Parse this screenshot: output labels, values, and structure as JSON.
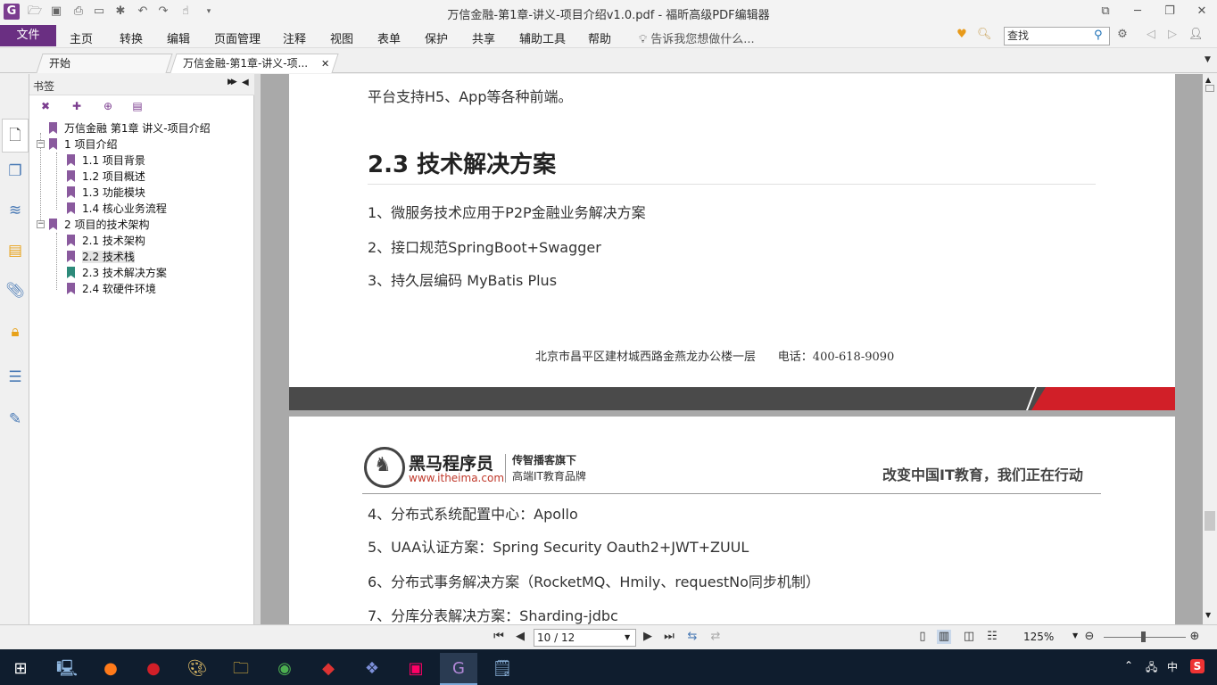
{
  "window": {
    "title": "万信金融-第1章-讲义-项目介绍v1.0.pdf - 福昕高级PDF编辑器",
    "app_logo": "G",
    "buttons": {
      "restore_layout": "⧉",
      "minimize": "─",
      "maximize": "❐",
      "close": "✕"
    }
  },
  "menu": {
    "file": "文件",
    "items": [
      "主页",
      "转换",
      "编辑",
      "页面管理",
      "注释",
      "视图",
      "表单",
      "保护",
      "共享",
      "辅助工具",
      "帮助"
    ],
    "tellme": "告诉我您想做什么...",
    "search_value": "查找"
  },
  "tabs": [
    {
      "label": "开始"
    },
    {
      "label": "万信金融-第1章-讲义-项...",
      "close": "✕"
    }
  ],
  "bookmarks": {
    "title": "书签",
    "collapse_glyph": "▶▶",
    "pin_glyph": "◀",
    "tree": [
      {
        "label": "万信金融 第1章 讲义-项目介绍"
      },
      {
        "label": "1 项目介绍",
        "toggle": "−"
      },
      {
        "label": "1.1 项目背景"
      },
      {
        "label": "1.2 项目概述"
      },
      {
        "label": "1.3 功能模块"
      },
      {
        "label": "1.4 核心业务流程"
      },
      {
        "label": "2 项目的技术架构",
        "toggle": "−"
      },
      {
        "label": "2.1 技术架构"
      },
      {
        "label": "2.2 技术栈"
      },
      {
        "label": "2.3 技术解决方案"
      },
      {
        "label": "2.4 软硬件环境"
      }
    ]
  },
  "document": {
    "page1": {
      "line_top": "平台支持H5、App等各种前端。",
      "heading": "2.3 技术解决方案",
      "items": [
        "1、微服务技术应用于P2P金融业务解决方案",
        "2、接口规范SpringBoot+Swagger",
        "3、持久层编码 MyBatis Plus"
      ],
      "footer": "北京市昌平区建材城西路金燕龙办公楼一层      电话：400-618-9090"
    },
    "page2": {
      "brand_name": "黑马程序员",
      "brand_url": "www.itheima.com",
      "brand_tag1": "传智播客旗下",
      "brand_tag2": "高端IT教育品牌",
      "slogan": "改变中国IT教育，我们正在行动",
      "items": [
        "4、分布式系统配置中心：Apollo",
        "5、UAA认证方案：Spring Security Oauth2+JWT+ZUUL",
        "6、分布式事务解决方案（RocketMQ、Hmily、requestNo同步机制）",
        "7、分库分表解决方案：Sharding-jdbc"
      ]
    }
  },
  "status": {
    "page_value": "10 / 12",
    "zoom": "125%"
  },
  "taskbar": {
    "tray_ime": "中",
    "tray_sogou": "S"
  },
  "colors": {
    "brand_purple": "#6a2f82",
    "bookmark_purple": "#8a5a9e",
    "bookmark_teal": "#2d8a7a",
    "footer_band_dark": "#4a4a4a",
    "footer_band_red": "#d11f28"
  }
}
